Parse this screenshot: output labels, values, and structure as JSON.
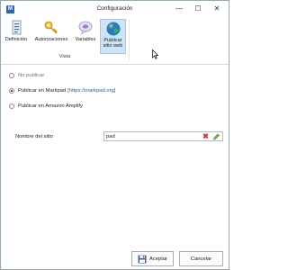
{
  "window": {
    "title": "Configuración",
    "icon_name": "app-icon",
    "minimize_glyph": "—",
    "maximize_glyph": "☐",
    "close_glyph": "✕"
  },
  "ribbon": {
    "group_label": "Vista",
    "buttons": [
      {
        "label": "Definición",
        "icon": "document-list-icon",
        "selected": false
      },
      {
        "label": "Autorizaciones",
        "icon": "key-icon",
        "selected": false
      },
      {
        "label": "Variables",
        "icon": "speech-bubble-icon",
        "selected": false
      },
      {
        "label_line1": "Publicar",
        "label_line2": "sitio web",
        "icon": "globe-icon",
        "selected": true
      }
    ]
  },
  "publish_options": [
    {
      "label": "No publicar",
      "checked": false,
      "enabled": false
    },
    {
      "label": "Publicar en Markpad",
      "link": "[https://markpad.org]",
      "checked": true,
      "enabled": true
    },
    {
      "label": "Publicar en Amazon Amplify",
      "checked": false,
      "enabled": false
    }
  ],
  "site_name": {
    "label": "Nombre del sitio",
    "value": "pad"
  },
  "footer": {
    "accept_label": "Aceptar",
    "cancel_label": "Cancelar"
  },
  "colors": {
    "selected_ribbon_bg": "#cde4f7",
    "link": "#1a5fb4",
    "clear_icon": "#d9342b"
  }
}
